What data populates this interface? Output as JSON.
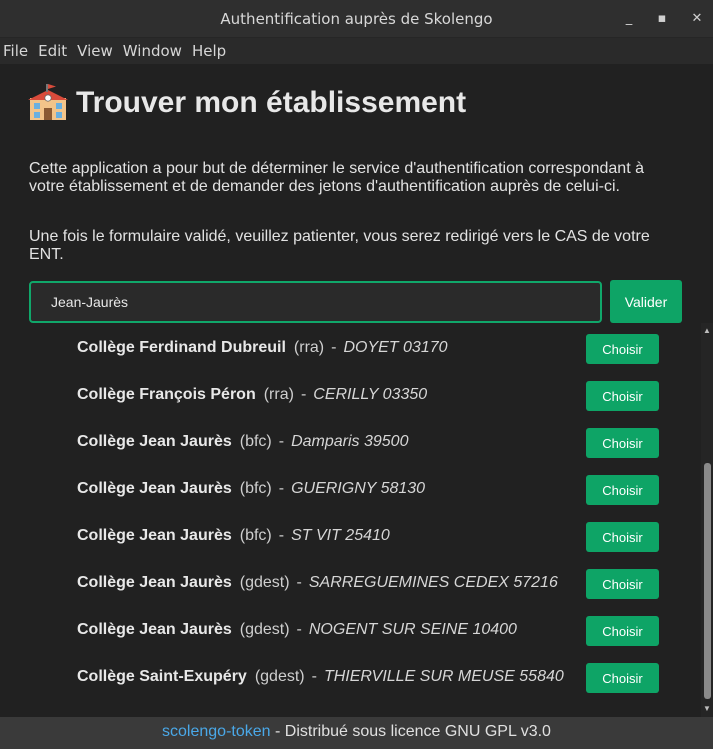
{
  "window": {
    "title": "Authentification auprès de Skolengo",
    "controls": {
      "minimize": "_",
      "maximize": "▪",
      "close": "✕"
    }
  },
  "menu": [
    "File",
    "Edit",
    "View",
    "Window",
    "Help"
  ],
  "page": {
    "heading_icon": "school-building-icon",
    "heading": "Trouver mon établissement",
    "paragraph1": "Cette application a pour but de déterminer le service d'authentification correspondant à votre établissement et de demander des jetons d'authentification auprès de celui-ci.",
    "paragraph2": "Une fois le formulaire validé, veuillez patienter, vous serez redirigé vers le CAS de votre ENT."
  },
  "search": {
    "value": "Jean-Jaurès",
    "submit_label": "Valider"
  },
  "results": [
    {
      "name": "Collège Ferdinand Dubreuil",
      "code": "(rra)",
      "sep": "-",
      "city": "DOYET 03170",
      "button": "Choisir"
    },
    {
      "name": "Collège François Péron",
      "code": "(rra)",
      "sep": "-",
      "city": "CERILLY 03350",
      "button": "Choisir"
    },
    {
      "name": "Collège Jean Jaurès",
      "code": "(bfc)",
      "sep": "-",
      "city": "Damparis 39500",
      "button": "Choisir"
    },
    {
      "name": "Collège Jean Jaurès",
      "code": "(bfc)",
      "sep": "-",
      "city": "GUERIGNY 58130",
      "button": "Choisir"
    },
    {
      "name": "Collège Jean Jaurès",
      "code": "(bfc)",
      "sep": "-",
      "city": "ST VIT 25410",
      "button": "Choisir"
    },
    {
      "name": "Collège Jean Jaurès",
      "code": "(gdest)",
      "sep": "-",
      "city": "SARREGUEMINES CEDEX 57216",
      "button": "Choisir"
    },
    {
      "name": "Collège Jean Jaurès",
      "code": "(gdest)",
      "sep": "-",
      "city": "NOGENT SUR SEINE 10400",
      "button": "Choisir"
    },
    {
      "name": "Collège Saint-Exupéry",
      "code": "(gdest)",
      "sep": "-",
      "city": "THIERVILLE SUR MEUSE 55840",
      "button": "Choisir"
    }
  ],
  "footer": {
    "link_text": "scolengo-token",
    "text": " - Distribué sous licence GNU GPL v3.0"
  },
  "colors": {
    "accent": "#0ea466",
    "link": "#4aa8e8",
    "background": "#212121"
  }
}
